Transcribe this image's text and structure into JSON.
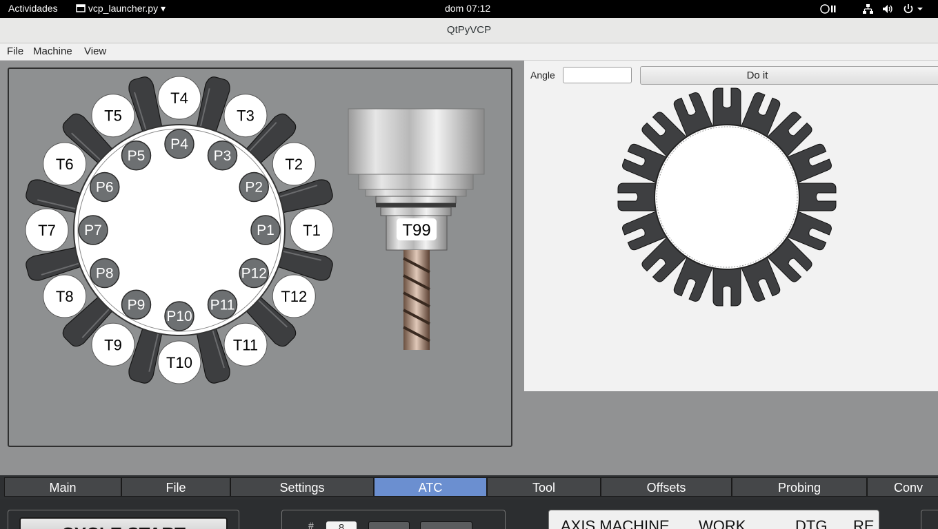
{
  "topbar": {
    "activities": "Actividades",
    "app_menu": "vcp_launcher.py",
    "clock": "dom 07:12"
  },
  "window": {
    "title": "QtPyVCP"
  },
  "menu": [
    "File",
    "Machine",
    "View"
  ],
  "carousel": {
    "tools": [
      "T1",
      "T2",
      "T3",
      "T4",
      "T5",
      "T6",
      "T7",
      "T8",
      "T9",
      "T10",
      "T11",
      "T12"
    ],
    "pockets": [
      "P1",
      "P2",
      "P3",
      "P4",
      "P5",
      "P6",
      "P7",
      "P8",
      "P9",
      "P10",
      "P11",
      "P12"
    ]
  },
  "spindle": {
    "tool_label": "T99"
  },
  "rotation": {
    "angle_label": "Angle",
    "angle_value": "",
    "do_it_label": "Do it"
  },
  "tabs": [
    {
      "label": "Main",
      "active": false
    },
    {
      "label": "File",
      "active": false
    },
    {
      "label": "Settings",
      "active": false
    },
    {
      "label": "ATC",
      "active": true
    },
    {
      "label": "Tool",
      "active": false
    },
    {
      "label": "Offsets",
      "active": false
    },
    {
      "label": "Probing",
      "active": false
    },
    {
      "label": "Conv",
      "active": false
    }
  ],
  "bottom": {
    "cycle_start": "CYCLE START",
    "spin_value": "8",
    "dro_headers": [
      "AXIS MACHINE",
      "WORK",
      "DTG",
      "RE"
    ]
  },
  "colors": {
    "active_tab": "#6b8fd0",
    "panel_bg": "#8e9091",
    "pocket": "#6d7072"
  }
}
